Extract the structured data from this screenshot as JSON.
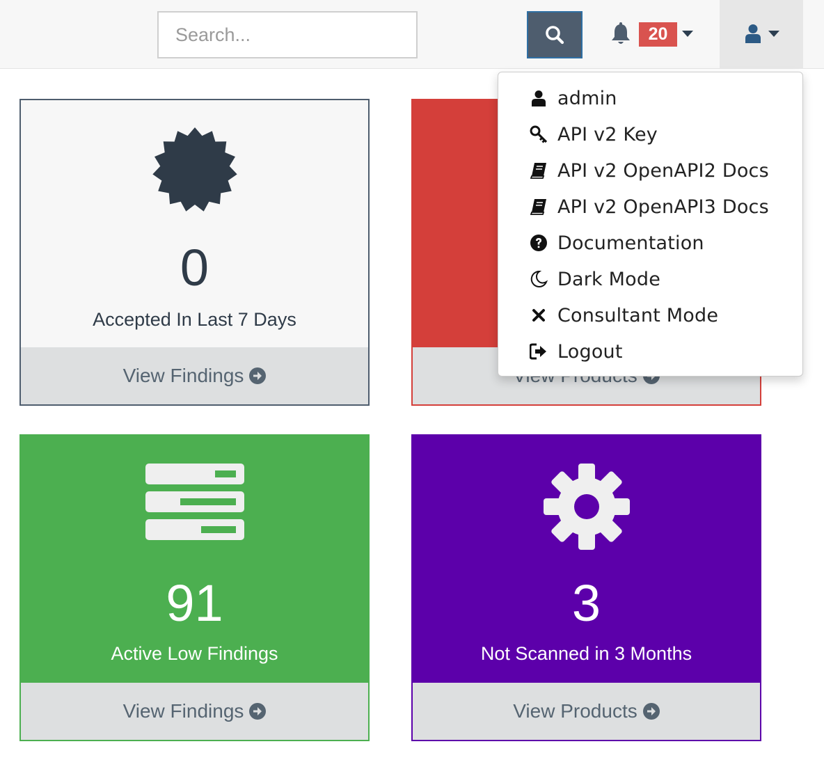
{
  "navbar": {
    "search": {
      "placeholder": "Search...",
      "value": ""
    },
    "search_button_icon": "search-icon",
    "notifications": {
      "icon": "bell-icon",
      "count": "20"
    },
    "user_menu_icon": "user-icon"
  },
  "user_dropdown": {
    "items": [
      {
        "icon": "user-icon",
        "label": "admin"
      },
      {
        "icon": "key-icon",
        "label": "API v2 Key"
      },
      {
        "icon": "book-icon",
        "label": "API v2 OpenAPI2 Docs"
      },
      {
        "icon": "book-icon",
        "label": "API v2 OpenAPI3 Docs"
      },
      {
        "icon": "question-circle-icon",
        "label": "Documentation"
      },
      {
        "icon": "moon-icon",
        "label": "Dark Mode"
      },
      {
        "icon": "close-icon",
        "label": "Consultant Mode"
      },
      {
        "icon": "sign-out-icon",
        "label": "Logout"
      }
    ]
  },
  "cards": [
    {
      "icon": "certificate-icon",
      "value": "0",
      "label": "Accepted In Last 7 Days",
      "footer": "View Findings",
      "color": "#f7f7f7"
    },
    {
      "icon": "",
      "value": "",
      "label": "",
      "footer": "View Products",
      "color": "#d43f3a"
    },
    {
      "icon": "list-icon",
      "value": "91",
      "label": "Active Low Findings",
      "footer": "View Findings",
      "color": "#4caf50"
    },
    {
      "icon": "gear-icon",
      "value": "3",
      "label": "Not Scanned in 3 Months",
      "footer": "View Products",
      "color": "#5c00aa"
    }
  ],
  "colors": {
    "navbar_button": "#4e5d6e",
    "badge": "#d9534f",
    "footer_text": "#556471"
  }
}
